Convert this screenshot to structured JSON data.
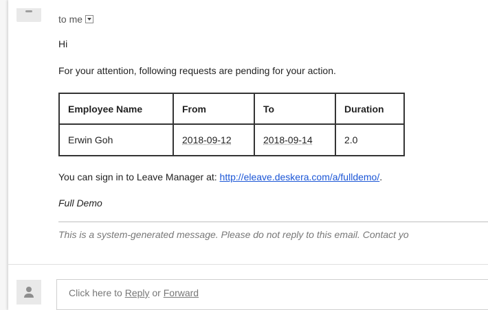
{
  "header": {
    "to_text": "to me"
  },
  "body": {
    "greeting": "Hi",
    "intro": "For your attention, following requests are pending for your action.",
    "table": {
      "headers": [
        "Employee Name",
        "From",
        "To",
        "Duration"
      ],
      "rows": [
        [
          "Erwin Goh",
          "2018-09-12",
          "2018-09-14",
          "2.0"
        ]
      ]
    },
    "signin_text": "You can sign in to Leave Manager at: ",
    "signin_link": "http://eleave.deskera.com/a/fulldemo/",
    "signin_end": ".",
    "signature": "Full Demo",
    "footer": "This is a system-generated message. Please do not reply to this email. Contact yo"
  },
  "reply": {
    "prefix": "Click here to ",
    "reply_label": "Reply",
    "or_text": " or ",
    "forward_label": "Forward"
  },
  "icons": {
    "avatar": "person-icon",
    "dropdown": "dropdown-arrow-icon"
  },
  "colors": {
    "link": "#1a55d6",
    "footer_text": "#777777",
    "table_border": "#333333"
  }
}
